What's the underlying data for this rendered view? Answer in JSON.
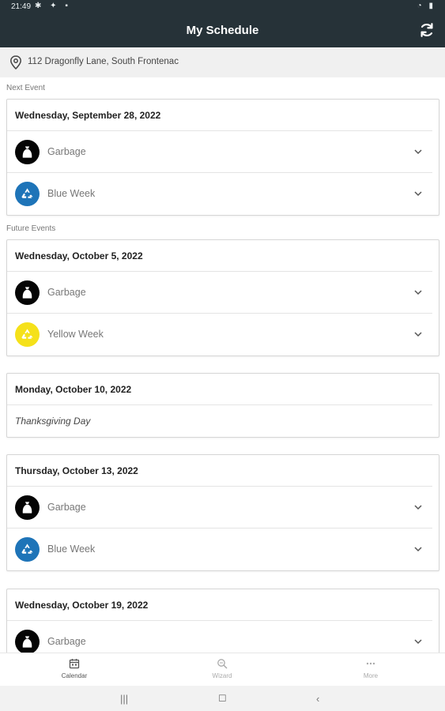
{
  "status_bar": {
    "time": "21:49"
  },
  "app_bar": {
    "title": "My Schedule",
    "refresh_icon": "refresh-icon"
  },
  "address": {
    "text": "112 Dragonfly Lane, South Frontenac",
    "icon": "location-pin-icon"
  },
  "sections": {
    "next_event_label": "Next Event",
    "future_events_label": "Future Events"
  },
  "cards": [
    {
      "date": "Wednesday, September 28, 2022",
      "events": [
        {
          "label": "Garbage",
          "icon": "garbage-bag-icon",
          "color": "#050505"
        },
        {
          "label": "Blue Week",
          "icon": "recycle-icon",
          "color": "#1e74b8"
        }
      ]
    },
    {
      "date": "Wednesday, October 5, 2022",
      "events": [
        {
          "label": "Garbage",
          "icon": "garbage-bag-icon",
          "color": "#050505"
        },
        {
          "label": "Yellow Week",
          "icon": "recycle-icon",
          "color": "#f5e11a"
        }
      ]
    },
    {
      "date": "Monday, October 10, 2022",
      "note": "Thanksgiving Day"
    },
    {
      "date": "Thursday, October 13, 2022",
      "events": [
        {
          "label": "Garbage",
          "icon": "garbage-bag-icon",
          "color": "#050505"
        },
        {
          "label": "Blue Week",
          "icon": "recycle-icon",
          "color": "#1e74b8"
        }
      ]
    },
    {
      "date": "Wednesday, October 19, 2022",
      "events": [
        {
          "label": "Garbage",
          "icon": "garbage-bag-icon",
          "color": "#050505"
        }
      ]
    }
  ],
  "bottom_nav": [
    {
      "label": "Calendar",
      "icon": "calendar-icon",
      "active": true
    },
    {
      "label": "Wizard",
      "icon": "search-icon",
      "active": false
    },
    {
      "label": "More",
      "icon": "more-icon",
      "active": false
    }
  ],
  "colors": {
    "app_bar": "#263238",
    "blue_week": "#1e74b8",
    "yellow_week": "#f5e11a",
    "garbage": "#050505"
  }
}
